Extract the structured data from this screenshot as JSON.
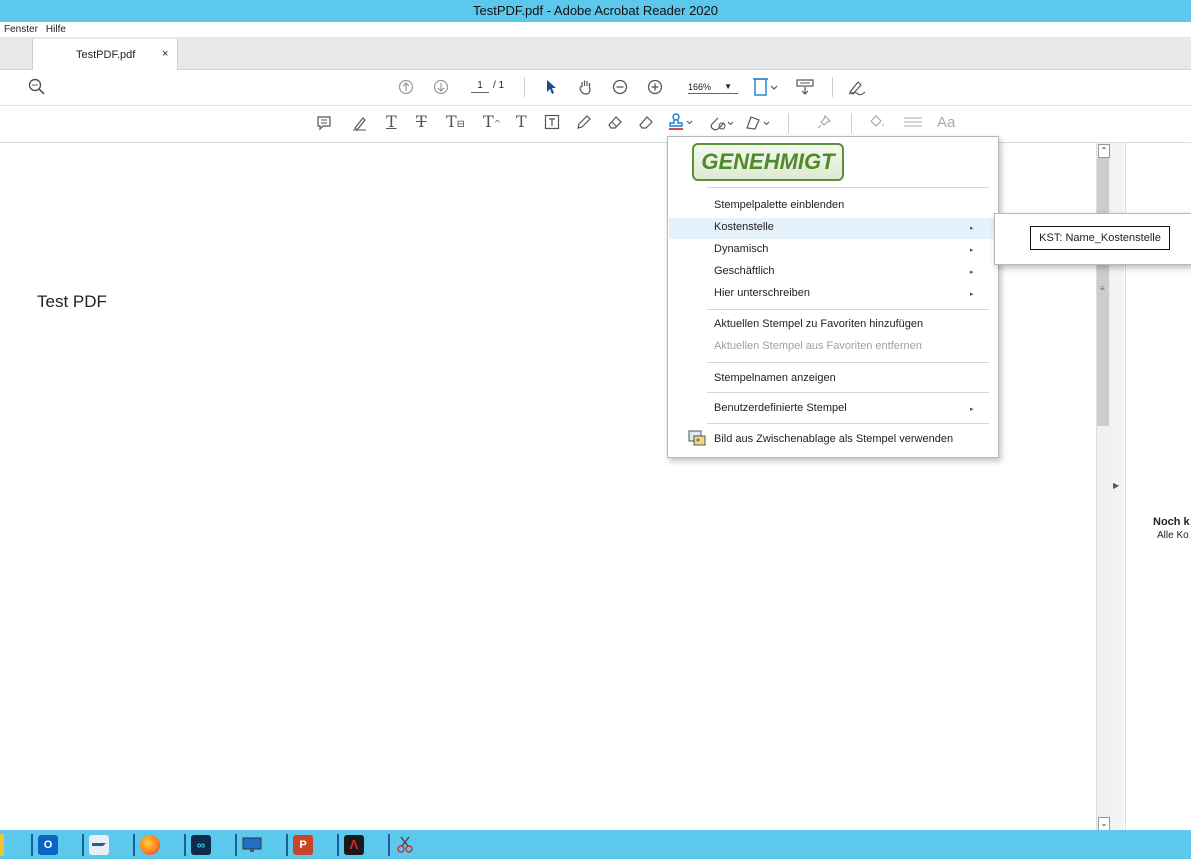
{
  "window": {
    "title": "TestPDF.pdf - Adobe Acrobat Reader 2020"
  },
  "menubar": {
    "items": [
      "Fenster",
      "Hilfe"
    ]
  },
  "tab": {
    "label": "TestPDF.pdf",
    "close": "×"
  },
  "toolbar": {
    "page_current": "1",
    "page_total": "/ 1",
    "zoom": "166%"
  },
  "document": {
    "text": "Test PDF"
  },
  "stamp_menu": {
    "preview_label": "GENEHMIGT",
    "items": [
      {
        "label": "Stempelpalette einblenden",
        "submenu": false,
        "disabled": false
      },
      {
        "label": "Kostenstelle",
        "submenu": true,
        "disabled": false
      },
      {
        "label": "Dynamisch",
        "submenu": true,
        "disabled": false
      },
      {
        "label": "Geschäftlich",
        "submenu": true,
        "disabled": false
      },
      {
        "label": "Hier unterschreiben",
        "submenu": true,
        "disabled": false
      },
      {
        "label": "Aktuellen Stempel zu Favoriten hinzufügen",
        "submenu": false,
        "disabled": false
      },
      {
        "label": "Aktuellen Stempel aus Favoriten entfernen",
        "submenu": false,
        "disabled": true
      },
      {
        "label": "Stempelnamen anzeigen",
        "submenu": false,
        "disabled": false
      },
      {
        "label": "Benutzerdefinierte Stempel",
        "submenu": true,
        "disabled": false
      },
      {
        "label": "Bild aus Zwischenablage als Stempel verwenden",
        "submenu": false,
        "disabled": false
      }
    ],
    "arrow": "▸"
  },
  "submenu": {
    "item": "KST: Name_Kostenstelle"
  },
  "right_panel": {
    "title": "Noch k",
    "subtitle": "Alle Ko"
  },
  "colors": {
    "titlebar": "#5bc8ec",
    "taskbar": "#5bc8ec",
    "stamp_green": "#4f8a2c",
    "hover": "#e5f1fb"
  }
}
